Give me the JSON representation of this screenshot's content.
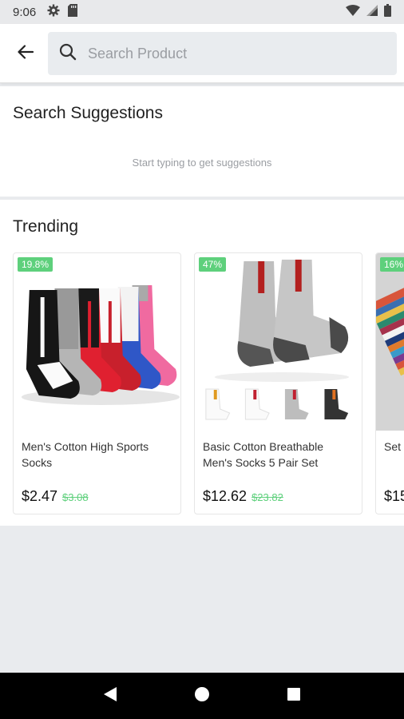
{
  "status_bar": {
    "time": "9:06",
    "icons_left": [
      "gear-icon",
      "sd-card-icon"
    ],
    "icons_right": [
      "wifi-icon",
      "cellular-icon",
      "battery-icon"
    ]
  },
  "header": {
    "back_icon": "arrow-left-icon",
    "search_icon": "search-icon",
    "search_placeholder": "Search Product",
    "search_value": ""
  },
  "suggestions": {
    "title": "Search Suggestions",
    "hint": "Start typing to get suggestions"
  },
  "trending": {
    "title": "Trending",
    "products": [
      {
        "discount": "19.8%",
        "name": "Men's Cotton High Sports Socks",
        "price": "$2.47",
        "old_price": "$3.08"
      },
      {
        "discount": "47%",
        "name": "Basic Cotton Breathable Men's Socks 5 Pair Set",
        "price": "$12.62",
        "old_price": "$23.82"
      },
      {
        "discount": "16%",
        "name": "Set of Socks Patt",
        "price": "$15",
        "old_price": ""
      }
    ]
  },
  "nav_bar": {
    "buttons": [
      "back-triangle-icon",
      "home-circle-icon",
      "recents-square-icon"
    ]
  },
  "colors": {
    "accent_green": "#5ed07c",
    "header_bg": "#ffffff",
    "page_bg": "#e9ebee"
  }
}
